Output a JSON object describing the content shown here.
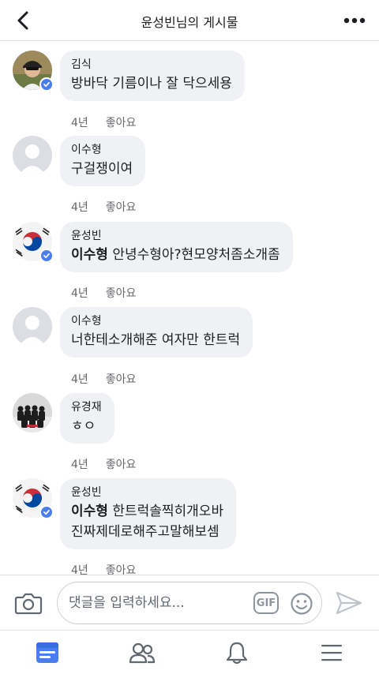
{
  "header": {
    "title": "윤성빈님의 게시물"
  },
  "comments": [
    {
      "author": "김식",
      "mention": "",
      "lines": [
        "방바닥 기름이나 잘 닥으세용"
      ],
      "time": "4년",
      "like": "좋아요",
      "avatar": "photo-man-cap",
      "verified": true
    },
    {
      "author": "이수형",
      "mention": "",
      "lines": [
        "구걸쟁이여"
      ],
      "time": "4년",
      "like": "좋아요",
      "avatar": "default-silhouette",
      "verified": false
    },
    {
      "author": "윤성빈",
      "mention": "이수형",
      "lines": [
        " 안녕수형아?현모양처좀소개좀"
      ],
      "time": "4년",
      "like": "좋아요",
      "avatar": "korea-flag",
      "verified": true
    },
    {
      "author": "이수형",
      "mention": "",
      "lines": [
        "너한테소개해준 여자만 한트럭"
      ],
      "time": "4년",
      "like": "좋아요",
      "avatar": "default-silhouette",
      "verified": false
    },
    {
      "author": "유경재",
      "mention": "",
      "lines": [
        "ㅎㅇ"
      ],
      "time": "4년",
      "like": "좋아요",
      "avatar": "group-photo",
      "verified": false
    },
    {
      "author": "윤성빈",
      "mention": "이수형",
      "lines": [
        " 한트럭솔찍히개오바",
        "진짜제데로해주고말해보셈"
      ],
      "time": "4년",
      "like": "좋아요",
      "avatar": "korea-flag",
      "verified": true
    }
  ],
  "composer": {
    "placeholder": "댓글을 입력하세요...",
    "gif_label": "GIF"
  },
  "tabbar": {
    "items": [
      "news-feed-icon",
      "friends-icon",
      "notifications-icon",
      "menu-icon"
    ]
  },
  "colors": {
    "accent": "#4a7ef0",
    "bubble": "#eff1f4",
    "muted": "#65676b"
  }
}
